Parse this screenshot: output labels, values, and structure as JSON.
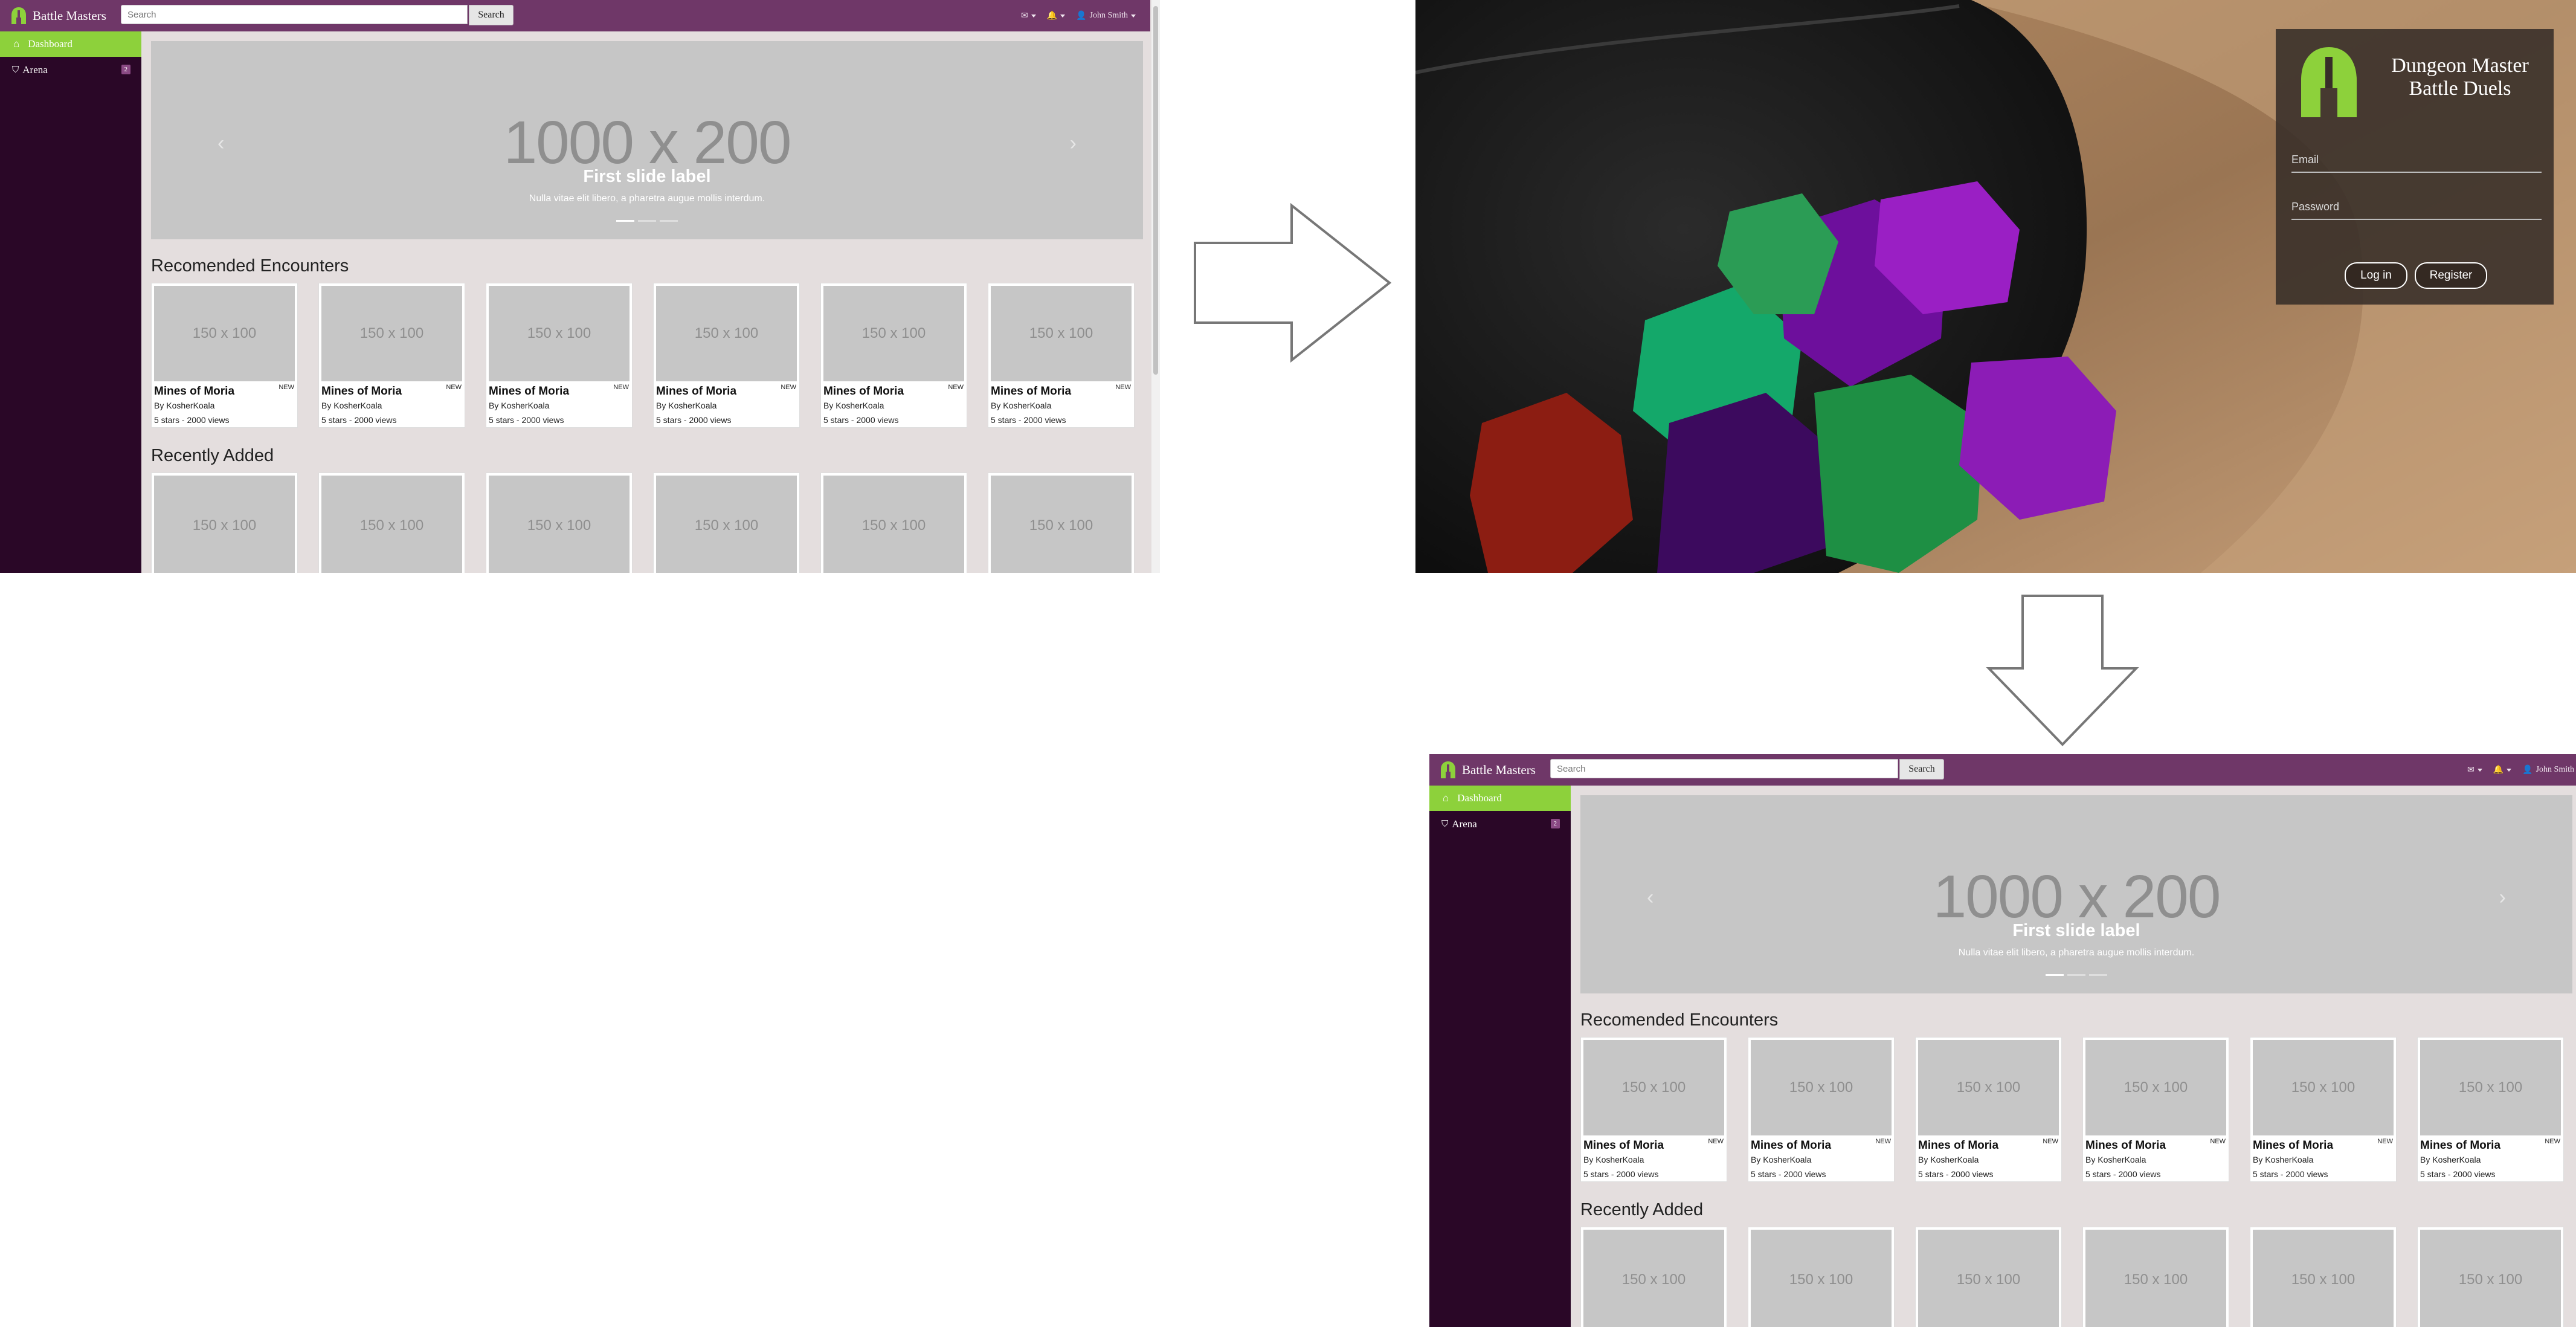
{
  "screen_a": {
    "brand": "Battle Masters",
    "search": {
      "placeholder": "Search",
      "button": "Search"
    },
    "nav": {
      "mail": "✉",
      "alerts": "🔔",
      "user": "John Smith"
    },
    "sidebar": {
      "items": [
        {
          "label": "Dashboard",
          "icon": "dashboard-icon"
        },
        {
          "label": "Arena",
          "icon": "helmet-icon",
          "badge": "2"
        }
      ]
    },
    "carousel": {
      "size_text": "1000 x 200",
      "caption": "First slide label",
      "text": "Nulla vitae elit libero, a pharetra augue mollis interdum.",
      "prev": "‹",
      "next": "›"
    },
    "sections": [
      {
        "title": "Recomended Encounters",
        "cards": [
          {
            "ph": "150 x 100",
            "name": "Mines of Moria",
            "badge": "NEW",
            "by": "By KosherKoala",
            "stats": "5 stars - 2000 views"
          },
          {
            "ph": "150 x 100",
            "name": "Mines of Moria",
            "badge": "NEW",
            "by": "By KosherKoala",
            "stats": "5 stars - 2000 views"
          },
          {
            "ph": "150 x 100",
            "name": "Mines of Moria",
            "badge": "NEW",
            "by": "By KosherKoala",
            "stats": "5 stars - 2000 views"
          },
          {
            "ph": "150 x 100",
            "name": "Mines of Moria",
            "badge": "NEW",
            "by": "By KosherKoala",
            "stats": "5 stars - 2000 views"
          },
          {
            "ph": "150 x 100",
            "name": "Mines of Moria",
            "badge": "NEW",
            "by": "By KosherKoala",
            "stats": "5 stars - 2000 views"
          },
          {
            "ph": "150 x 100",
            "name": "Mines of Moria",
            "badge": "NEW",
            "by": "By KosherKoala",
            "stats": "5 stars - 2000 views"
          }
        ]
      },
      {
        "title": "Recently Added",
        "cards": [
          {
            "ph": "150 x 100"
          },
          {
            "ph": "150 x 100"
          },
          {
            "ph": "150 x 100"
          },
          {
            "ph": "150 x 100"
          },
          {
            "ph": "150 x 100"
          },
          {
            "ph": "150 x 100"
          }
        ]
      }
    ]
  },
  "login": {
    "title_line1": "Dungeon Master",
    "title_line2": "Battle Duels",
    "email_placeholder": "Email",
    "password_placeholder": "Password",
    "login_button": "Log in",
    "register_button": "Register"
  },
  "colors": {
    "topbar": "#6f3768",
    "sidebar": "#2a0727",
    "accent": "#8dd13b"
  }
}
